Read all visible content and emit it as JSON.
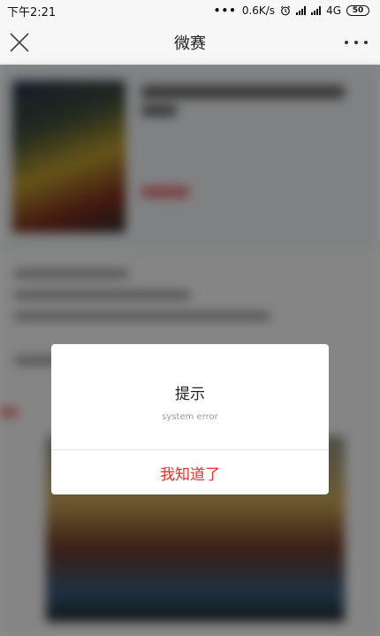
{
  "status_bar": {
    "time": "下午2:21",
    "dots": "•••",
    "speed": "0.6K/s",
    "network": "4G",
    "battery": "50",
    "icons": [
      "alarm-icon",
      "signal-icon",
      "signal-icon",
      "battery-icon"
    ]
  },
  "nav": {
    "title": "微赛",
    "close_icon": "close-icon",
    "more_icon": "more-icon"
  },
  "dialog": {
    "title": "提示",
    "message": "system error",
    "button_label": "我知道了",
    "button_color": "#e0322e"
  },
  "colors": {
    "overlay": "#000000",
    "accent": "#e0322e"
  }
}
